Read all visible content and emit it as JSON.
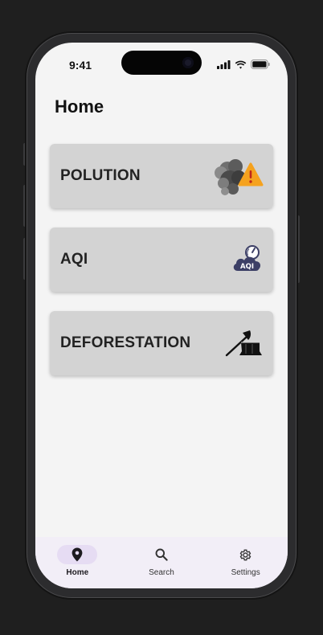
{
  "status_bar": {
    "time": "9:41"
  },
  "header": {
    "title": "Home"
  },
  "cards": [
    {
      "label": "POLUTION",
      "icon": "pollution-smoke-warning-icon"
    },
    {
      "label": "AQI",
      "icon": "aqi-cloud-gauge-icon"
    },
    {
      "label": "DEFORESTATION",
      "icon": "axe-tree-stump-icon"
    }
  ],
  "nav": {
    "items": [
      {
        "label": "Home",
        "icon": "location-pin-icon",
        "active": true
      },
      {
        "label": "Search",
        "icon": "search-icon",
        "active": false
      },
      {
        "label": "Settings",
        "icon": "gear-icon",
        "active": false
      }
    ]
  },
  "colors": {
    "background": "#1f1f1f",
    "screen": "#f4f4f4",
    "card": "#d3d3d3",
    "navbar": "#f2eef7",
    "nav_active_pill": "#e6dcf3",
    "warning": "#f5a21e",
    "aqi_badge": "#3c3f66"
  }
}
